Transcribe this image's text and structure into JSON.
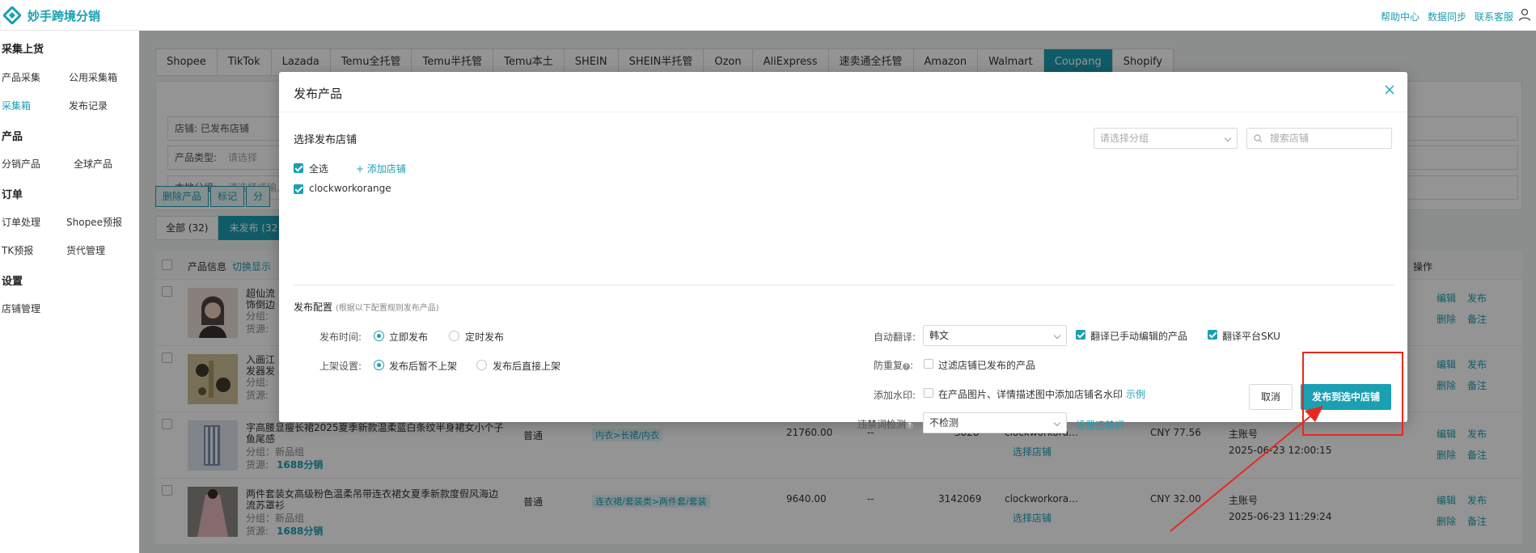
{
  "app": {
    "title": "妙手跨境分销"
  },
  "top_links": [
    "帮助中心",
    "数据同步",
    "联系客服"
  ],
  "sidebar": {
    "sections": [
      {
        "title": "采集上货",
        "items": [
          "产品采集",
          "公用采集箱",
          "采集箱",
          "发布记录"
        ]
      },
      {
        "title": "产品",
        "items": [
          "分销产品",
          "全球产品"
        ]
      },
      {
        "title": "订单",
        "items": [
          "订单处理",
          "Shopee预报",
          "TK预报",
          "货代管理"
        ]
      },
      {
        "title": "设置",
        "items": [
          "店铺管理"
        ]
      }
    ],
    "active": "采集箱"
  },
  "platform_tabs": [
    "Shopee",
    "TikTok",
    "Lazada",
    "Temu全托管",
    "Temu半托管",
    "Temu本土",
    "SHEIN",
    "SHEIN半托管",
    "Ozon",
    "AliExpress",
    "速卖通全托管",
    "Amazon",
    "Walmart",
    "Coupang",
    "Shopify"
  ],
  "platform_active": "Coupang",
  "filters": {
    "shop_label": "店铺:",
    "shop_value": "已发布店铺",
    "type_label": "产品类型:",
    "type_placeholder": "请选择",
    "group_label": "本地分组:",
    "group_placeholder": "请选择或输入"
  },
  "action_buttons": [
    "删除产品",
    "标记",
    "分"
  ],
  "status_tabs": {
    "all": "全部 (32)",
    "unpublished": "未发布 (32"
  },
  "table": {
    "header": {
      "product_info": "产品信息",
      "switch_display": "切换显示",
      "ops": "操作"
    },
    "rows": [
      {
        "title": "超仙流",
        "subtitle": "饰倒边",
        "group": "分组:",
        "source": "货源:",
        "ops": [
          "编辑",
          "发布",
          "删除",
          "备注"
        ]
      },
      {
        "title": "入画江",
        "subtitle": "发器发",
        "group": "分组:",
        "source": "货源:",
        "ops": [
          "编辑",
          "发布",
          "删除",
          "备注"
        ]
      },
      {
        "title": "字高腰显瘦长裙2025夏季新款温柔蓝白条纹半身裙女小个子",
        "subtitle": "鱼尾感",
        "group": "分组：新品组",
        "source_label": "货源:",
        "source_value": "1688分销",
        "type": "普通",
        "category": "内衣>长裙/内衣",
        "price": "21760.00",
        "dash": "--",
        "stock": "3828",
        "shop": "clockworkora…",
        "select_shop": "选择店铺",
        "cny": "CNY 77.56",
        "account": "主账号",
        "date": "2025-06-23 12:00:15",
        "ops": [
          "编辑",
          "发布",
          "删除",
          "备注"
        ]
      },
      {
        "title": "两件套装女高级粉色温柔吊带连衣裙女夏季新款度假风海边",
        "subtitle": "流苏罩衫",
        "group": "分组：新品组",
        "source_label": "货源:",
        "source_value": "1688分销",
        "type": "普通",
        "category": "连衣裙/套装类>两件套/套装",
        "price": "9640.00",
        "dash": "--",
        "stock": "3142069",
        "shop": "clockworkora…",
        "select_shop": "选择店铺",
        "cny": "CNY 32.00",
        "account": "主账号",
        "date": "2025-06-23 11:29:24",
        "ops": [
          "编辑",
          "发布",
          "删除",
          "备注"
        ]
      }
    ]
  },
  "modal": {
    "title": "发布产品",
    "select_shop_label": "选择发布店铺",
    "group_placeholder": "请选择分组",
    "search_placeholder": "搜索店铺",
    "select_all": "全选",
    "add_shop": "添加店铺",
    "shop_name": "clockworkorange",
    "config_label": "发布配置",
    "config_hint": "(根据以下配置规则发布产品)",
    "publish_time_label": "发布时间:",
    "publish_now": "立即发布",
    "publish_scheduled": "定时发布",
    "listing_label": "上架设置:",
    "listing_hold": "发布后暂不上架",
    "listing_direct": "发布后直接上架",
    "auto_translate_label": "自动翻译:",
    "translate_value": "韩文",
    "translate_edited": "翻译已手动编辑的产品",
    "translate_sku": "翻译平台SKU",
    "dedupe_label": "防重复",
    "dedupe_option": "过滤店铺已发布的产品",
    "watermark_label": "添加水印:",
    "watermark_option": "在产品图片、详情描述图中添加店铺名水印",
    "watermark_example": "示例",
    "forbidden_label": "违禁词检测",
    "forbidden_value": "不检测",
    "forbidden_setting": "设置违禁词",
    "cancel": "取消",
    "publish": "发布到选中店铺"
  },
  "colors": {
    "accent": "#1a9fb3",
    "annotation": "#e8281c"
  }
}
